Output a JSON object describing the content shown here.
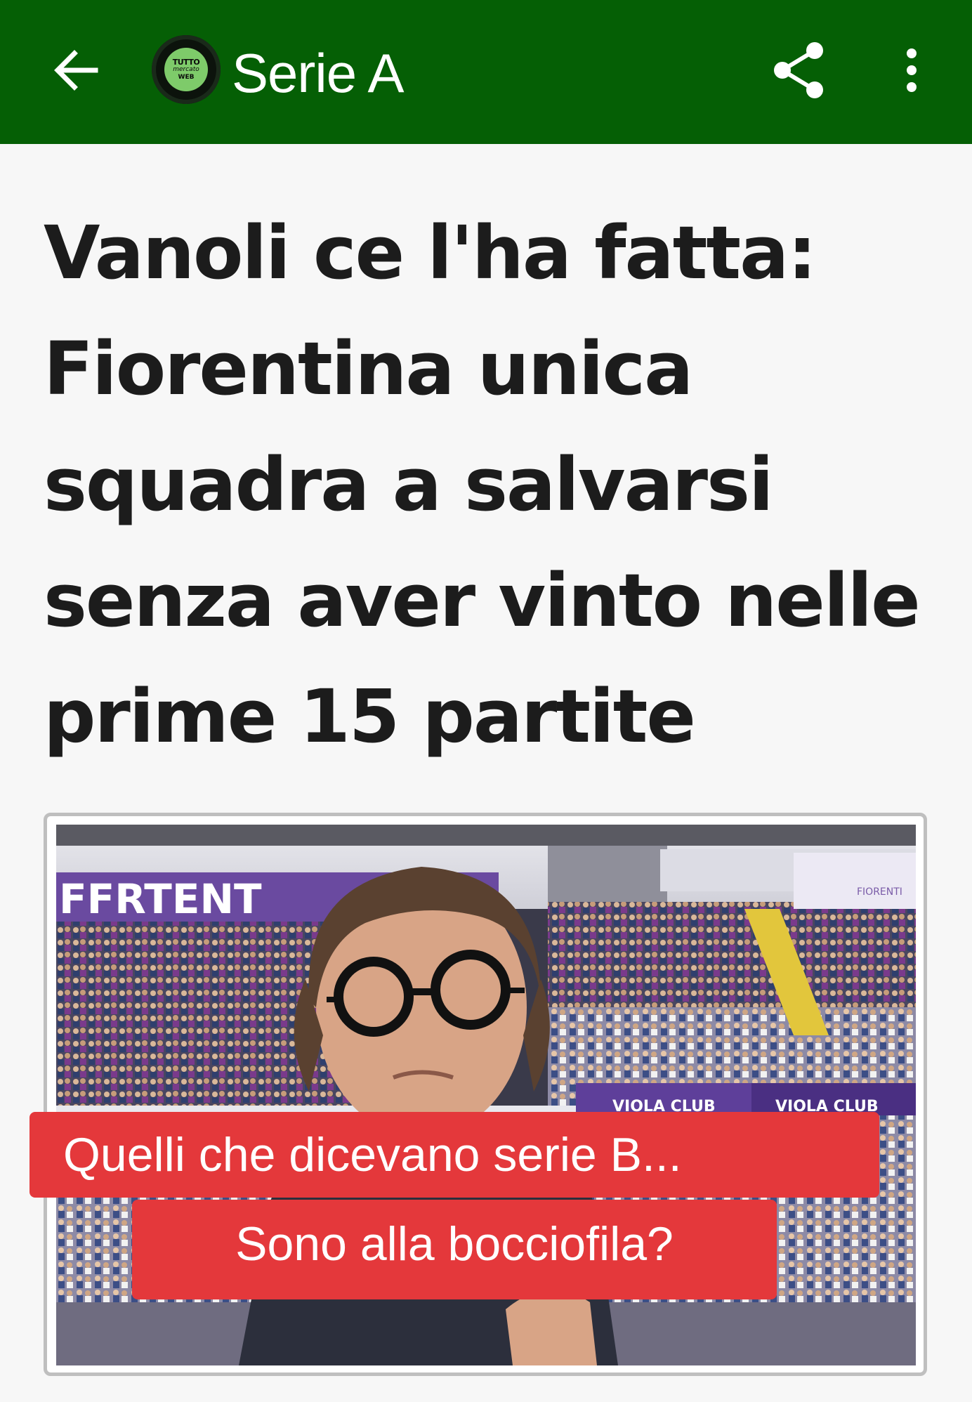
{
  "app_bar": {
    "title": "Serie A",
    "logo_text": [
      "TUTTO",
      "mercato",
      "WEB"
    ],
    "background_color": "#055f05",
    "icons": [
      "arrow-left-icon",
      "share-icon",
      "more-vert-icon"
    ]
  },
  "article": {
    "headline": "Vanoli ce l'ha fatta: Fiorentina unica squadra a salvarsi senza aver vinto nelle prime 15 partite",
    "image": {
      "stadium_sign": "FFRTENT",
      "banner_left": "VIOLA CLUB",
      "banner_right": "VIOLA CLUB",
      "corner_sign": "FIORENTI"
    },
    "overlay_caption": {
      "line1": "Quelli che dicevano serie B...",
      "line2": "Sono alla bocciofila?",
      "color": "#e4383b"
    }
  }
}
